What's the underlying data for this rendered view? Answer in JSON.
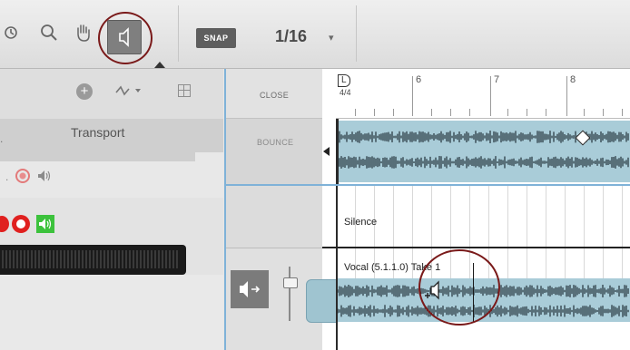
{
  "toolbar": {
    "tools": [
      "undo-icon",
      "zoom-icon",
      "hand-icon",
      "speaker-icon"
    ],
    "snap_label": "SNAP",
    "snap_value": "1/16",
    "snap_caret": "▾"
  },
  "left_panel": {
    "header_icons": [
      "add-icon",
      "automation-icon",
      "grid-icon"
    ],
    "transport_label": "Transport"
  },
  "timeline": {
    "close_label": "CLOSE",
    "bounce_label": "BOUNCE",
    "ruler": {
      "locator": "L",
      "signature": "4/4",
      "bars": [
        "6",
        "7",
        "8"
      ]
    },
    "tracks": [
      {
        "name": "Silence"
      },
      {
        "name": "Vocal (5.1.1.0) Take 1"
      }
    ]
  },
  "colors": {
    "accent_blue": "#7fb2d8",
    "wave_fill": "#9fc4d0",
    "record_red": "#e0201f",
    "mute_green": "#3cc23c",
    "highlight_circle": "#7a1a1a"
  }
}
